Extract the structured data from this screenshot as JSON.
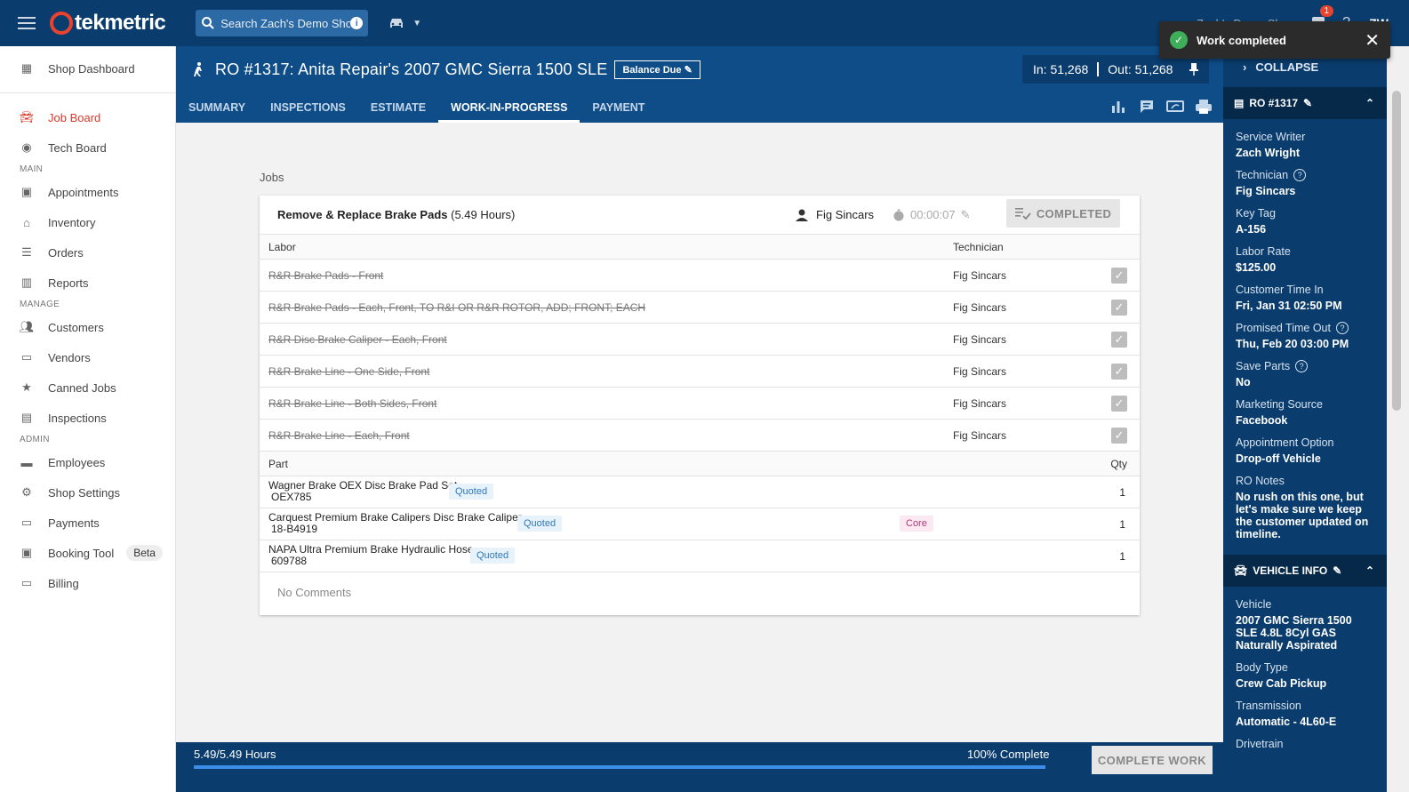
{
  "topbar": {
    "logo_text": "tekmetric",
    "search_placeholder": "Search Zach's Demo Shop",
    "shop_name": "Zach's Demo Shop",
    "notification_count": "1",
    "avatar_initials": "ZW"
  },
  "toast": {
    "message": "Work completed"
  },
  "sidebar": {
    "items_top": [
      {
        "label": "Shop Dashboard",
        "icon": "dashboard-icon"
      }
    ],
    "items_boards": [
      {
        "label": "Job Board",
        "icon": "car-icon",
        "active": true
      },
      {
        "label": "Tech Board",
        "icon": "gauge-icon"
      }
    ],
    "section_main": "MAIN",
    "items_main": [
      {
        "label": "Appointments",
        "icon": "calendar-icon"
      },
      {
        "label": "Inventory",
        "icon": "warehouse-icon"
      },
      {
        "label": "Orders",
        "icon": "list-icon"
      },
      {
        "label": "Reports",
        "icon": "bar-chart-icon"
      }
    ],
    "section_manage": "MANAGE",
    "items_manage": [
      {
        "label": "Customers",
        "icon": "people-icon"
      },
      {
        "label": "Vendors",
        "icon": "store-icon"
      },
      {
        "label": "Canned Jobs",
        "icon": "star-icon"
      },
      {
        "label": "Inspections",
        "icon": "clipboard-icon"
      }
    ],
    "section_admin": "ADMIN",
    "items_admin": [
      {
        "label": "Employees",
        "icon": "badge-icon"
      },
      {
        "label": "Shop Settings",
        "icon": "gear-icon"
      },
      {
        "label": "Payments",
        "icon": "cash-icon"
      },
      {
        "label": "Booking Tool",
        "icon": "calendar-check-icon",
        "badge": "Beta"
      },
      {
        "label": "Billing",
        "icon": "credit-card-icon"
      }
    ]
  },
  "ro": {
    "title": "RO #1317: Anita Repair's 2007 GMC Sierra 1500 SLE",
    "balance_badge": "Balance Due",
    "mileage_in": "In: 51,268",
    "mileage_out": "Out: 51,268",
    "tabs": [
      "SUMMARY",
      "INSPECTIONS",
      "ESTIMATE",
      "WORK-IN-PROGRESS",
      "PAYMENT"
    ],
    "active_tab": "WORK-IN-PROGRESS"
  },
  "jobs": {
    "section_label": "Jobs",
    "job_title": "Remove & Replace Brake Pads",
    "job_hours": "(5.49 Hours)",
    "technician": "Fig Sincars",
    "timer": "00:00:07",
    "completed_label": "COMPLETED",
    "labor_header": "Labor",
    "technician_header": "Technician",
    "labor": [
      {
        "desc": "R&R Brake Pads - Front",
        "tech": "Fig Sincars",
        "done": true
      },
      {
        "desc": "R&R Brake Pads - Each, Front, TO R&I OR R&R ROTOR, ADD; FRONT; EACH",
        "tech": "Fig Sincars",
        "done": true
      },
      {
        "desc": "R&R Disc Brake Caliper - Each, Front",
        "tech": "Fig Sincars",
        "done": true
      },
      {
        "desc": "R&R Brake Line - One Side, Front",
        "tech": "Fig Sincars",
        "done": true
      },
      {
        "desc": "R&R Brake Line - Both Sides, Front",
        "tech": "Fig Sincars",
        "done": true
      },
      {
        "desc": "R&R Brake Line - Each, Front",
        "tech": "Fig Sincars",
        "done": true
      }
    ],
    "part_header": "Part",
    "qty_header": "Qty",
    "parts": [
      {
        "name": "Wagner Brake OEX Disc Brake Pad Set",
        "number": "OEX785",
        "status": "Quoted",
        "core": "",
        "qty": "1"
      },
      {
        "name": "Carquest Premium Brake Calipers Disc Brake Caliper",
        "number": "18-B4919",
        "status": "Quoted",
        "core": "Core",
        "qty": "1"
      },
      {
        "name": "NAPA Ultra Premium Brake Hydraulic Hose",
        "number": "609788",
        "status": "Quoted",
        "core": "",
        "qty": "1"
      }
    ],
    "no_comments": "No Comments"
  },
  "footer": {
    "hours": "5.49/5.49 Hours",
    "percent_label": "100% Complete",
    "progress": 1.0,
    "complete_work_label": "COMPLETE WORK"
  },
  "rpanel": {
    "collapse_label": "COLLAPSE",
    "ro_section": "RO #1317",
    "fields": [
      {
        "label": "Service Writer",
        "value": "Zach Wright",
        "help": false
      },
      {
        "label": "Technician",
        "value": "Fig Sincars",
        "help": true
      },
      {
        "label": "Key Tag",
        "value": "A-156",
        "help": false
      },
      {
        "label": "Labor Rate",
        "value": "$125.00",
        "help": false
      },
      {
        "label": "Customer Time In",
        "value": "Fri, Jan 31 02:50 PM",
        "help": false
      },
      {
        "label": "Promised Time Out",
        "value": "Thu, Feb 20 03:00 PM",
        "help": true
      },
      {
        "label": "Save Parts",
        "value": "No",
        "help": true
      },
      {
        "label": "Marketing Source",
        "value": "Facebook",
        "help": false
      },
      {
        "label": "Appointment Option",
        "value": "Drop-off Vehicle",
        "help": false
      },
      {
        "label": "RO Notes",
        "value": "No rush on this one, but let's make sure we keep the customer updated on timeline.",
        "help": false
      }
    ],
    "vehicle_section": "VEHICLE INFO",
    "vehicle_fields": [
      {
        "label": "Vehicle",
        "value": "2007 GMC Sierra 1500 SLE 4.8L 8Cyl GAS Naturally Aspirated"
      },
      {
        "label": "Body Type",
        "value": "Crew Cab Pickup"
      },
      {
        "label": "Transmission",
        "value": "Automatic - 4L60-E"
      },
      {
        "label": "Drivetrain",
        "value": ""
      }
    ]
  }
}
